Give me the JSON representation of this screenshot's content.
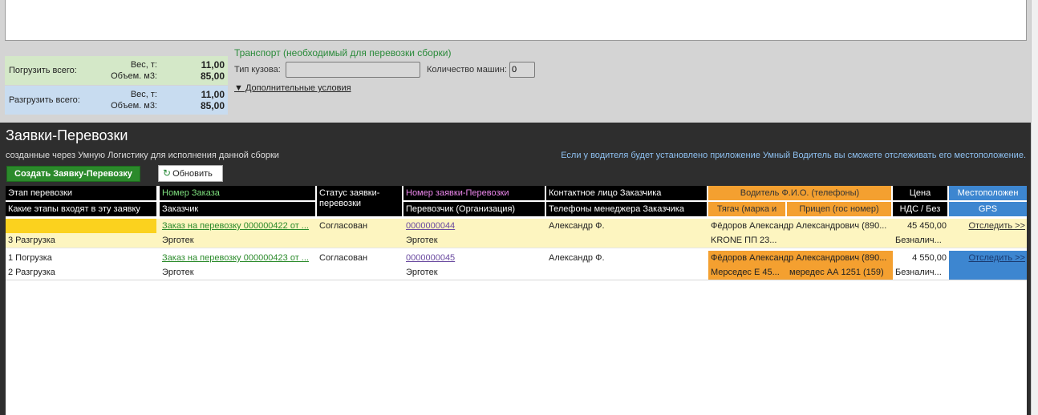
{
  "totals": {
    "load_title": "Погрузить всего:",
    "unload_title": "Разгрузить всего:",
    "weight_label": "Вес, т:",
    "volume_label": "Объем. м3:",
    "load_weight": "11,00",
    "load_volume": "85,00",
    "unload_weight": "11,00",
    "unload_volume": "85,00"
  },
  "transport": {
    "title": "Транспорт (необходимый для перевозки сборки)",
    "body_type_label": "Тип кузова:",
    "body_type_value": "",
    "cars_count_label": "Количество машин:",
    "cars_count_value": "0",
    "extra_conditions": "▼ Дополнительные условия"
  },
  "section": {
    "title": "Заявки-Перевозки",
    "subtitle": "созданные через Умную Логистику для исполнения данной сборки",
    "note": "Если у водителя будет установлено приложение Умный Водитель вы сможете отслеживать его местоположение.",
    "create_button": "Создать Заявку-Перевозку",
    "refresh_button": "Обновить"
  },
  "columns": {
    "stage": "Этап перевозки",
    "stages_in": "Какие этапы входят в эту заявку",
    "order_no": "Номер Заказа",
    "customer": "Заказчик",
    "status": "Статус заявки-перевозки",
    "request_no": "Номер заявки-Перевозки",
    "carrier": "Перевозчик (Организация)",
    "contact": "Контактное лицо Заказчика",
    "manager_phones": "Телефоны менеджера Заказчика",
    "driver": "Водитель Ф.И.О. (телефоны)",
    "tractor": "Тягач (марка и",
    "trailer": "Прицеп (гос номер)",
    "price": "Цена",
    "vat": "НДС / Без",
    "location": "Местоположен",
    "gps": "GPS"
  },
  "rows": [
    {
      "stage_a": "",
      "stage_b": "3 Разгрузка",
      "order": "Заказ на перевозку 000000422 от ...",
      "customer": "Эрготек",
      "status": "Согласован",
      "request": "0000000044",
      "carrier": "Эрготек",
      "contact": "Александр Ф.",
      "driver": "Фёдоров Александр Александрович (890...",
      "tractor": "KRONE  ПП 23...",
      "trailer": "",
      "price": "45 450,00",
      "vat": "Безналич...",
      "track": "Отследить >>"
    },
    {
      "stage_a": "1 Погрузка",
      "stage_b": "2 Разгрузка",
      "order": "Заказ на перевозку 000000423 от ...",
      "customer": "Эрготек",
      "status": "Согласован",
      "request": "0000000045",
      "carrier": "Эрготек",
      "contact": "Александр Ф.",
      "driver": "Фёдоров Александр Александрович (890...",
      "tractor": "Мерседес Е 45...",
      "trailer": "мередес АА 1251 (159)",
      "price": "4 550,00",
      "vat": "Безналич...",
      "track": "Отследить >>"
    }
  ]
}
